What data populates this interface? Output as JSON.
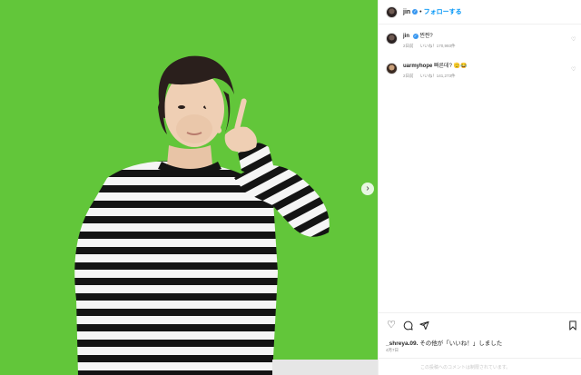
{
  "post": {
    "username": "jin",
    "dot": "•",
    "follow_label": "フォローする",
    "next_arrow": "›"
  },
  "comments": [
    {
      "username": "jin",
      "text": "찐찐?",
      "time": "2日前",
      "likes": "いいね！170,993件"
    },
    {
      "username": "uarmyhope",
      "text": "빠른데? 🫡😂",
      "time": "2日前",
      "likes": "いいね！141,273件"
    }
  ],
  "footer": {
    "liked_by_user": "_shreya.09.",
    "liked_by_rest": "その他が「いいね！」しました",
    "date": "4月7日",
    "comments_limited": "この投稿へのコメントは制限されています。"
  },
  "colors": {
    "background_green": "#62c63a",
    "link_blue": "#0095f6",
    "verified_blue": "#3897f0"
  },
  "icons": [
    "heart-icon",
    "comment-icon",
    "share-icon",
    "bookmark-icon",
    "chevron-right-icon",
    "verified-icon"
  ]
}
